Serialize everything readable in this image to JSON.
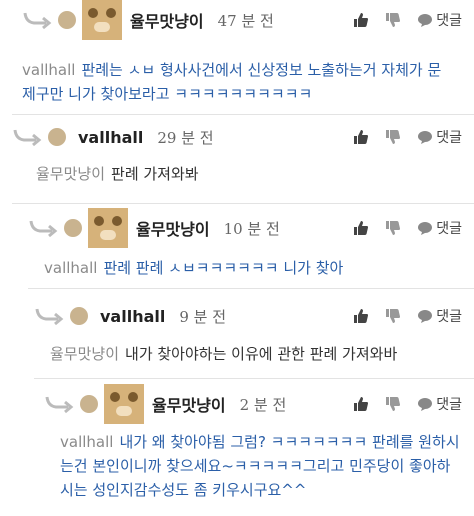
{
  "actions": {
    "reply_label": "댓글"
  },
  "comments": [
    {
      "nickname": "율무맛냥이",
      "time": "47 분 전",
      "reply_to": "vallhall",
      "text": "판례는 ㅅㅂ 형사사건에서 신상정보 노출하는거 자체가 문제구만 니가 찾아보라고 ㅋㅋㅋㅋㅋㅋㅋㅋㅋㅋ",
      "avatar": "cat-photo",
      "text_color": "#2b5fa8"
    },
    {
      "nickname": "vallhall",
      "time": "29 분 전",
      "reply_to": "율무맛냥이",
      "text": "판례 가져와봐",
      "avatar": "plain-dot",
      "text_color": "#333333"
    },
    {
      "nickname": "율무맛냥이",
      "time": "10 분 전",
      "reply_to": "vallhall",
      "text": "판례 판례 ㅅㅂㅋㅋㅋㅋㅋㅋ 니가 찾아",
      "avatar": "cat-photo",
      "text_color": "#2b5fa8"
    },
    {
      "nickname": "vallhall",
      "time": "9 분 전",
      "reply_to": "율무맛냥이",
      "text": "내가 찾아야하는 이유에 관한 판례 가져와바",
      "avatar": "plain-dot",
      "text_color": "#333333"
    },
    {
      "nickname": "율무맛냥이",
      "time": "2 분 전",
      "reply_to": "vallhall",
      "text": "내가 왜 찾아야됨 그럼? ㅋㅋㅋㅋㅋㅋㅋ 판례를 원하시는건 본인이니까 찾으세요~ㅋㅋㅋㅋㅋ그리고 민주당이 좋아하시는 성인지감수성도 좀 키우시구요^^",
      "avatar": "cat-photo",
      "text_color": "#2b5fa8"
    }
  ],
  "icons": {
    "reply_arrow": "reply-arrow-icon",
    "like": "thumbs-up-icon",
    "dislike": "thumbs-down-icon",
    "comment": "speech-bubble-icon"
  }
}
